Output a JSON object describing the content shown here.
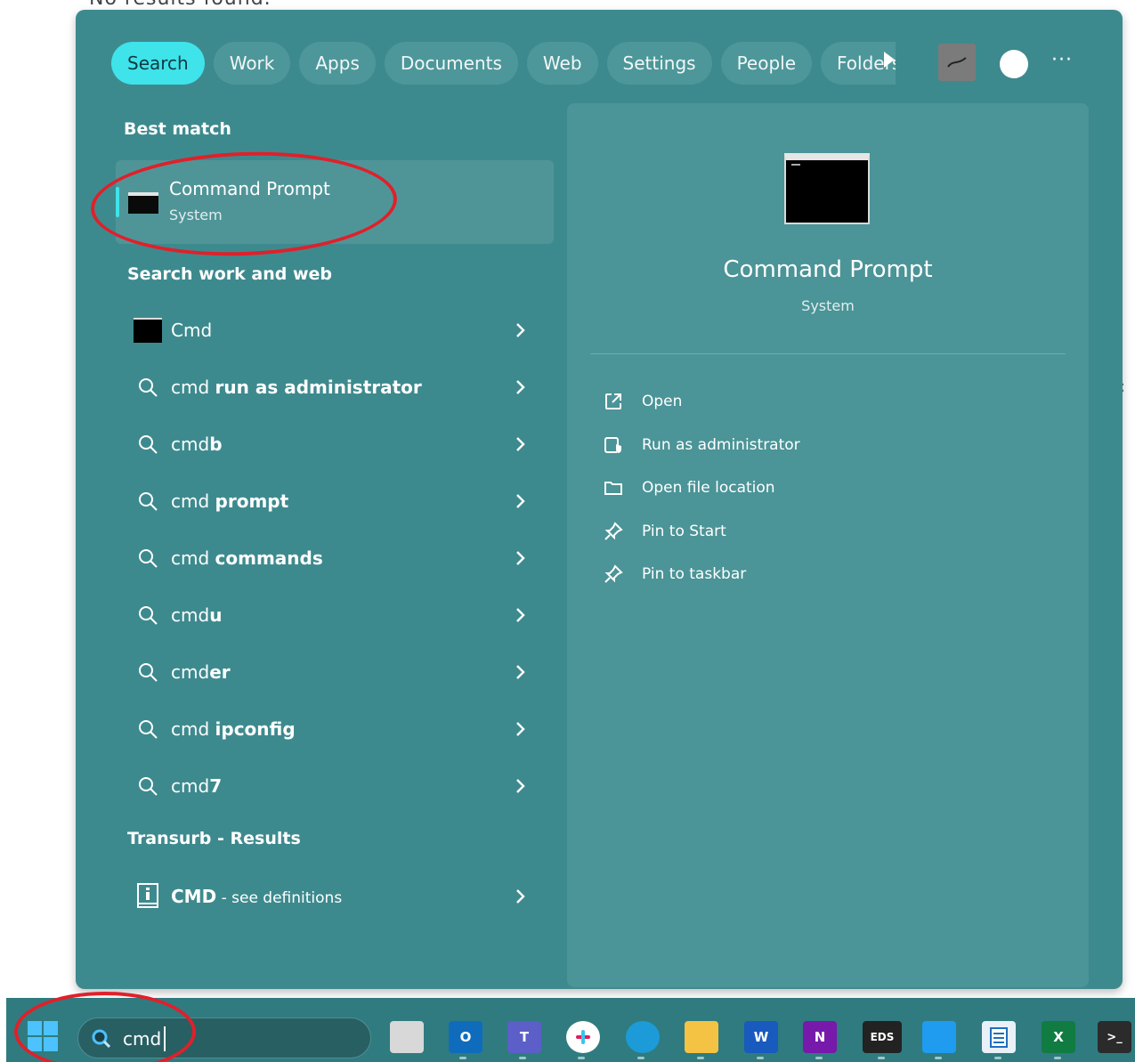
{
  "background_text": "No results found.",
  "filters": {
    "tabs": [
      {
        "label": "Search",
        "active": true
      },
      {
        "label": "Work",
        "active": false
      },
      {
        "label": "Apps",
        "active": false
      },
      {
        "label": "Documents",
        "active": false
      },
      {
        "label": "Web",
        "active": false
      },
      {
        "label": "Settings",
        "active": false
      },
      {
        "label": "People",
        "active": false
      },
      {
        "label": "Folders",
        "active": false
      }
    ],
    "more_label": "···"
  },
  "best_match": {
    "heading": "Best match",
    "title": "Command Prompt",
    "subtitle": "System"
  },
  "search_web": {
    "heading": "Search work and web",
    "items": [
      {
        "prefix": "Cmd",
        "suffix": "",
        "icon": "cmd-app-icon"
      },
      {
        "prefix": "cmd ",
        "suffix": "run as administrator",
        "icon": "search-icon"
      },
      {
        "prefix": "cmd",
        "suffix": "b",
        "icon": "search-icon"
      },
      {
        "prefix": "cmd ",
        "suffix": "prompt",
        "icon": "search-icon"
      },
      {
        "prefix": "cmd ",
        "suffix": "commands",
        "icon": "search-icon"
      },
      {
        "prefix": "cmd",
        "suffix": "u",
        "icon": "search-icon"
      },
      {
        "prefix": "cmd",
        "suffix": "er",
        "icon": "search-icon"
      },
      {
        "prefix": "cmd ",
        "suffix": "ipconfig",
        "icon": "search-icon"
      },
      {
        "prefix": "cmd",
        "suffix": "7",
        "icon": "search-icon"
      }
    ]
  },
  "transurb": {
    "heading": "Transurb - Results",
    "item_main": "CMD",
    "item_sub": " - see definitions"
  },
  "detail": {
    "title": "Command Prompt",
    "subtitle": "System",
    "actions": [
      {
        "label": "Open",
        "icon": "open-external-icon"
      },
      {
        "label": "Run as administrator",
        "icon": "shield-admin-icon"
      },
      {
        "label": "Open file location",
        "icon": "folder-icon"
      },
      {
        "label": "Pin to Start",
        "icon": "pin-icon"
      },
      {
        "label": "Pin to taskbar",
        "icon": "pin-icon"
      }
    ]
  },
  "taskbar": {
    "search_value": "cmd",
    "apps": [
      {
        "name": "task-view",
        "text": "",
        "color": "#d8d8d8"
      },
      {
        "name": "outlook",
        "text": "O",
        "color": "#0f6cbd"
      },
      {
        "name": "teams",
        "text": "T",
        "color": "#5b5fc7"
      },
      {
        "name": "slack",
        "text": "",
        "color": "#ffffff"
      },
      {
        "name": "edge",
        "text": "",
        "color": "#1c9bd8"
      },
      {
        "name": "file-explorer",
        "text": "",
        "color": "#f5c343"
      },
      {
        "name": "word",
        "text": "W",
        "color": "#185abd"
      },
      {
        "name": "onenote",
        "text": "N",
        "color": "#7719aa"
      },
      {
        "name": "eds",
        "text": "EDS",
        "color": "#222222"
      },
      {
        "name": "vscode",
        "text": "",
        "color": "#1f9cf0"
      },
      {
        "name": "notepad",
        "text": "",
        "color": "#e8f0f8"
      },
      {
        "name": "excel",
        "text": "X",
        "color": "#107c41"
      },
      {
        "name": "terminal",
        "text": ">_",
        "color": "#2b2b2b"
      }
    ]
  },
  "colors": {
    "panel": "#3d8a8e",
    "accent": "#3fe3ea",
    "annotation": "#e0202a"
  }
}
